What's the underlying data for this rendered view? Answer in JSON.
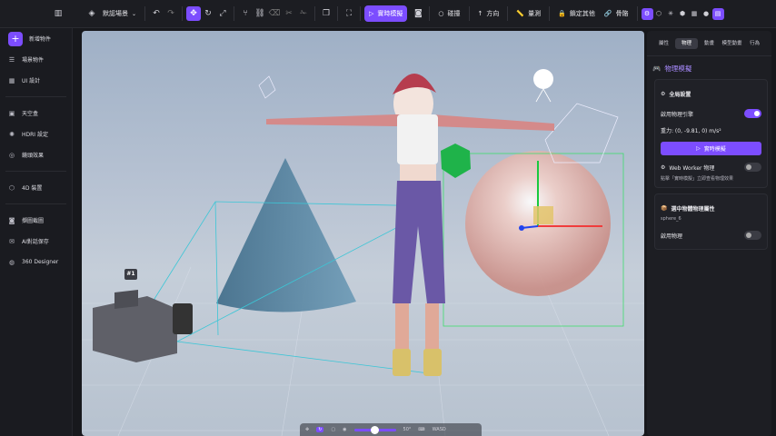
{
  "topbar": {
    "scene_label": "默認場景",
    "simulate_label": "實時模擬",
    "collision_label": "碰撞",
    "direction_label": "方向",
    "measure_label": "量測",
    "lock_label": "鎖定其他",
    "bones_label": "骨骼"
  },
  "sidebar": {
    "items": [
      {
        "label": "新增物件",
        "icon": "plus-icon"
      },
      {
        "label": "場景物件",
        "icon": "list-icon"
      },
      {
        "label": "UI 設計",
        "icon": "grid-icon"
      },
      {
        "label": "天空盒",
        "icon": "skybox-icon"
      },
      {
        "label": "HDRI 設定",
        "icon": "hdri-icon"
      },
      {
        "label": "鏡頭效果",
        "icon": "lens-icon"
      },
      {
        "label": "4D 裝置",
        "icon": "device-icon"
      },
      {
        "label": "擷圖截圖",
        "icon": "camera-icon"
      },
      {
        "label": "AI對話保存",
        "icon": "chat-icon"
      },
      {
        "label": "360 Designer",
        "icon": "globe-icon"
      }
    ]
  },
  "viewport": {
    "camera_tag": "#1",
    "bottom_value": "50°",
    "bottom_label": "WASD"
  },
  "panel": {
    "tabs": [
      "屬性",
      "物理",
      "動畫",
      "模型動畫",
      "行為"
    ],
    "active_tab": "物理",
    "title": "物理模擬",
    "global_title": "全局設置",
    "engine_label": "啟用物理引擎",
    "gravity_text": "重力: (0, -9.81, 0) m/s²",
    "simulate_button": "實時模擬",
    "web_worker_label": "Web Worker 物理",
    "hint_text": "點擊「實時模擬」立即查看物理效果",
    "selected_title": "選中物體物理屬性",
    "selected_object": "sphere_6",
    "enable_physics_label": "啟用物理"
  },
  "colors": {
    "accent": "#7c4dff",
    "panel_bg": "#1d1e23",
    "sidebar_bg": "#1a1b20"
  }
}
